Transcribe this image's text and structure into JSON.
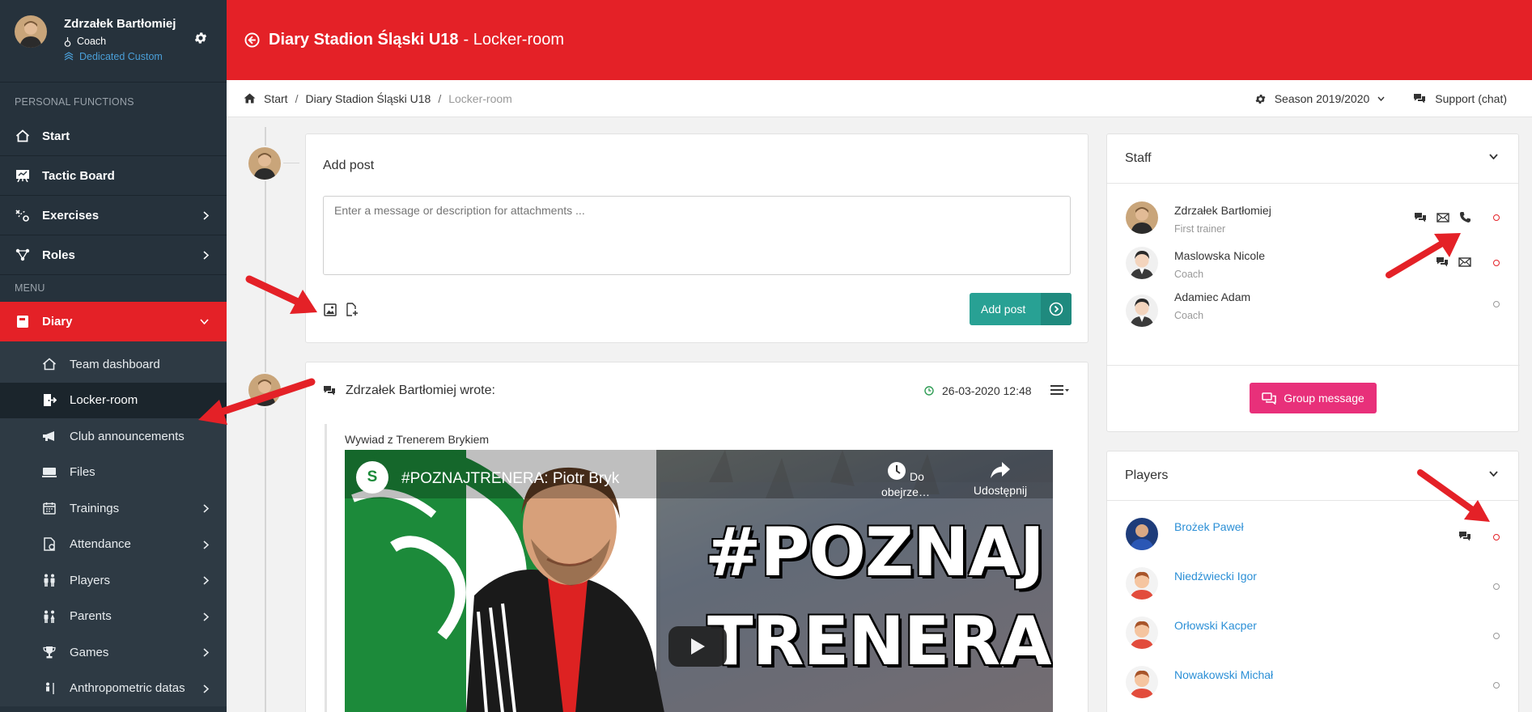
{
  "profile": {
    "name": "Zdrzałek Bartłomiej",
    "role": "Coach",
    "team": "Dedicated Custom"
  },
  "sidebar": {
    "section_personal": "PERSONAL FUNCTIONS",
    "personal_items": [
      {
        "label": "Start",
        "icon": "home-icon"
      },
      {
        "label": "Tactic Board",
        "icon": "tactic-board-icon"
      },
      {
        "label": "Exercises",
        "icon": "exercises-icon"
      },
      {
        "label": "Roles",
        "icon": "roles-icon"
      }
    ],
    "section_menu": "MENU",
    "diary_label": "Diary",
    "diary_items": [
      {
        "label": "Team dashboard"
      },
      {
        "label": "Locker-room"
      },
      {
        "label": "Club announcements"
      },
      {
        "label": "Files"
      },
      {
        "label": "Trainings"
      },
      {
        "label": "Attendance"
      },
      {
        "label": "Players"
      },
      {
        "label": "Parents"
      },
      {
        "label": "Games"
      },
      {
        "label": "Anthropometric datas"
      }
    ]
  },
  "header": {
    "team": "Diary Stadion Śląski U18",
    "page": "- Locker-room"
  },
  "breadcrumb": {
    "items": [
      "Start",
      "Diary Stadion Śląski U18",
      "Locker-room"
    ],
    "season": "Season 2019/2020",
    "support": "Support (chat)"
  },
  "add_post": {
    "title": "Add post",
    "placeholder": "Enter a message or description for attachments ...",
    "button": "Add post"
  },
  "post": {
    "author": "Zdrzałek Bartłomiej wrote:",
    "date": "26-03-2020 12:48",
    "text": "Wywiad z Trenerem Brykiem",
    "video": {
      "title": "#POZNAJTRENERA: Piotr Bryk",
      "watch_later": "Do obejrze…",
      "share": "Udostępnij",
      "overlay_line1": "#POZNAJ",
      "overlay_line2": "TRENERA",
      "channel_badge": "S"
    }
  },
  "staff": {
    "title": "Staff",
    "members": [
      {
        "name": "Zdrzałek Bartłomiej",
        "role": "First trainer"
      },
      {
        "name": "Maslowska Nicole",
        "role": "Coach"
      },
      {
        "name": "Adamiec Adam",
        "role": "Coach"
      }
    ],
    "group_button": "Group message"
  },
  "players": {
    "title": "Players",
    "members": [
      {
        "name": "Brożek Paweł"
      },
      {
        "name": "Niedźwiecki Igor"
      },
      {
        "name": "Orłowski Kacper"
      },
      {
        "name": "Nowakowski Michał"
      }
    ]
  },
  "colors": {
    "brand_red": "#e42127",
    "sidebar": "#26323c",
    "teal": "#28a194",
    "pink": "#e8307a",
    "link": "#2b8fd6"
  }
}
